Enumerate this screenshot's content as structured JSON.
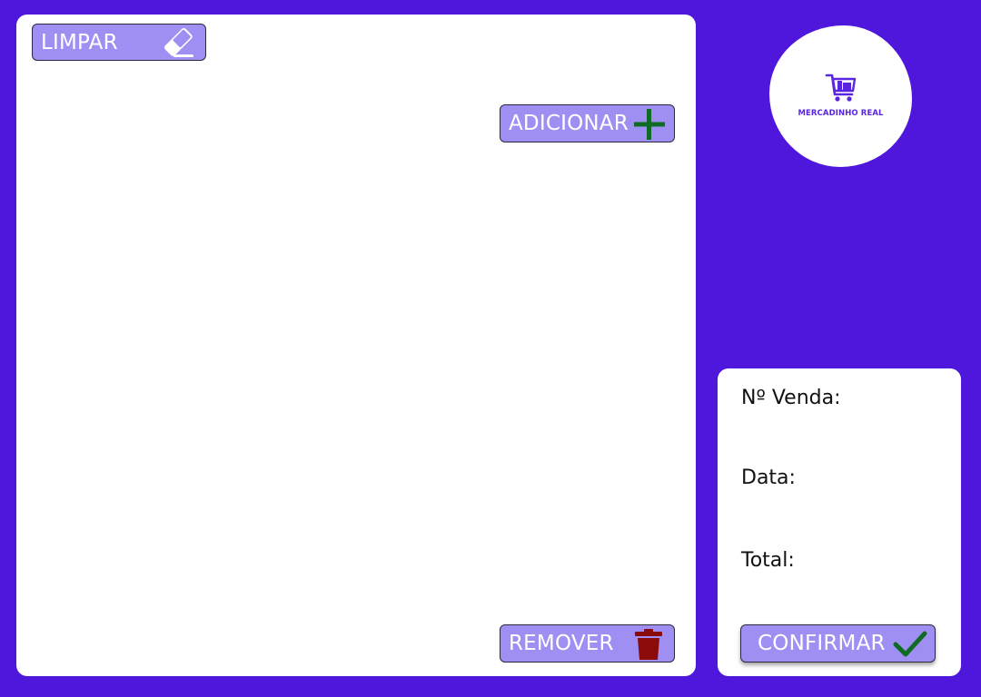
{
  "toolbar": {
    "clear_label": "LIMPAR",
    "clear_icon": "eraser-icon",
    "add_label": "ADICIONAR",
    "add_icon": "plus-icon",
    "remove_label": "REMOVER",
    "remove_icon": "trash-icon"
  },
  "brand": {
    "name": "MERCADINHO REAL",
    "logo_icon": "shopping-cart-icon"
  },
  "sale": {
    "number_label": "Nº Venda:",
    "date_label": "Data:",
    "total_label": "Total:",
    "confirm_label": "CONFIRMAR",
    "confirm_icon": "checkmark-icon"
  },
  "colors": {
    "background": "#4f17dc",
    "button": "#a08ff3",
    "add_icon": "#0f6b24",
    "remove_icon": "#8b0a0a",
    "confirm_icon": "#0f6b24"
  }
}
